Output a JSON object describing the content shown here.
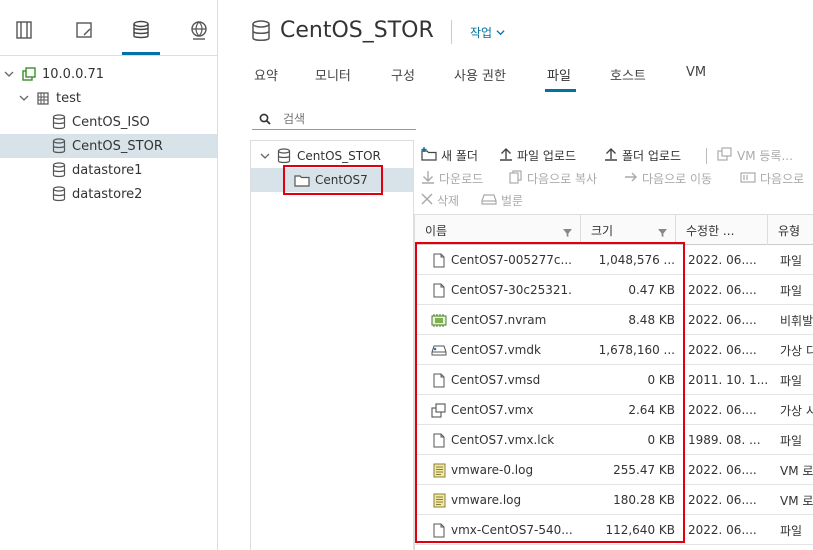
{
  "nav_tree": {
    "root": "10.0.0.71",
    "datacenter": "test",
    "datastores": [
      "CentOS_ISO",
      "CentOS_STOR",
      "datastore1",
      "datastore2"
    ]
  },
  "header": {
    "title": "CentOS_STOR",
    "action_label": "작업"
  },
  "tabs": [
    "요약",
    "모니터",
    "구성",
    "사용 권한",
    "파일",
    "호스트",
    "VM"
  ],
  "search": {
    "placeholder": "검색"
  },
  "folder_tree": {
    "root": "CentOS_STOR",
    "child": "CentOS7"
  },
  "toolbar": {
    "new_folder": "새 폴더",
    "upload_file": "파일 업로드",
    "upload_folder": "폴더 업로드",
    "register_vm": "VM 등록...",
    "download": "다운로드",
    "copy_to": "다음으로 복사",
    "move_to": "다음으로 이동",
    "rename_to": "다음으로",
    "delete": "삭제",
    "inflate": "벌룬"
  },
  "table": {
    "columns": [
      "이름",
      "크기",
      "수정한 ...",
      "유형"
    ],
    "rows": [
      {
        "name": "CentOS7-005277c...",
        "size": "1,048,576 ...",
        "date": "2022. 06....",
        "type": "파일",
        "icon": "file-icon"
      },
      {
        "name": "CentOS7-30c25321...",
        "size": "0.47 KB",
        "date": "2022. 06....",
        "type": "파일",
        "icon": "file-icon"
      },
      {
        "name": "CentOS7.nvram",
        "size": "8.48 KB",
        "date": "2022. 06....",
        "type": "비휘발",
        "icon": "nvram-icon"
      },
      {
        "name": "CentOS7.vmdk",
        "size": "1,678,160 ...",
        "date": "2022. 06....",
        "type": "가상 디",
        "icon": "disk-icon"
      },
      {
        "name": "CentOS7.vmsd",
        "size": "0 KB",
        "date": "2011. 10. 1...",
        "type": "파일",
        "icon": "file-icon"
      },
      {
        "name": "CentOS7.vmx",
        "size": "2.64 KB",
        "date": "2022. 06....",
        "type": "가상 시",
        "icon": "vm-icon"
      },
      {
        "name": "CentOS7.vmx.lck",
        "size": "0 KB",
        "date": "1989. 08. ...",
        "type": "파일",
        "icon": "file-icon"
      },
      {
        "name": "vmware-0.log",
        "size": "255.47 KB",
        "date": "2022. 06....",
        "type": "VM 로",
        "icon": "log-icon"
      },
      {
        "name": "vmware.log",
        "size": "180.28 KB",
        "date": "2022. 06....",
        "type": "VM 로",
        "icon": "log-icon"
      },
      {
        "name": "vmx-CentOS7-540...",
        "size": "112,640 KB",
        "date": "2022. 06....",
        "type": "파일",
        "icon": "file-icon"
      }
    ]
  },
  "colors": {
    "accent": "#0072a3",
    "highlight_box": "#e0000f",
    "selection": "#d8e3e9"
  }
}
